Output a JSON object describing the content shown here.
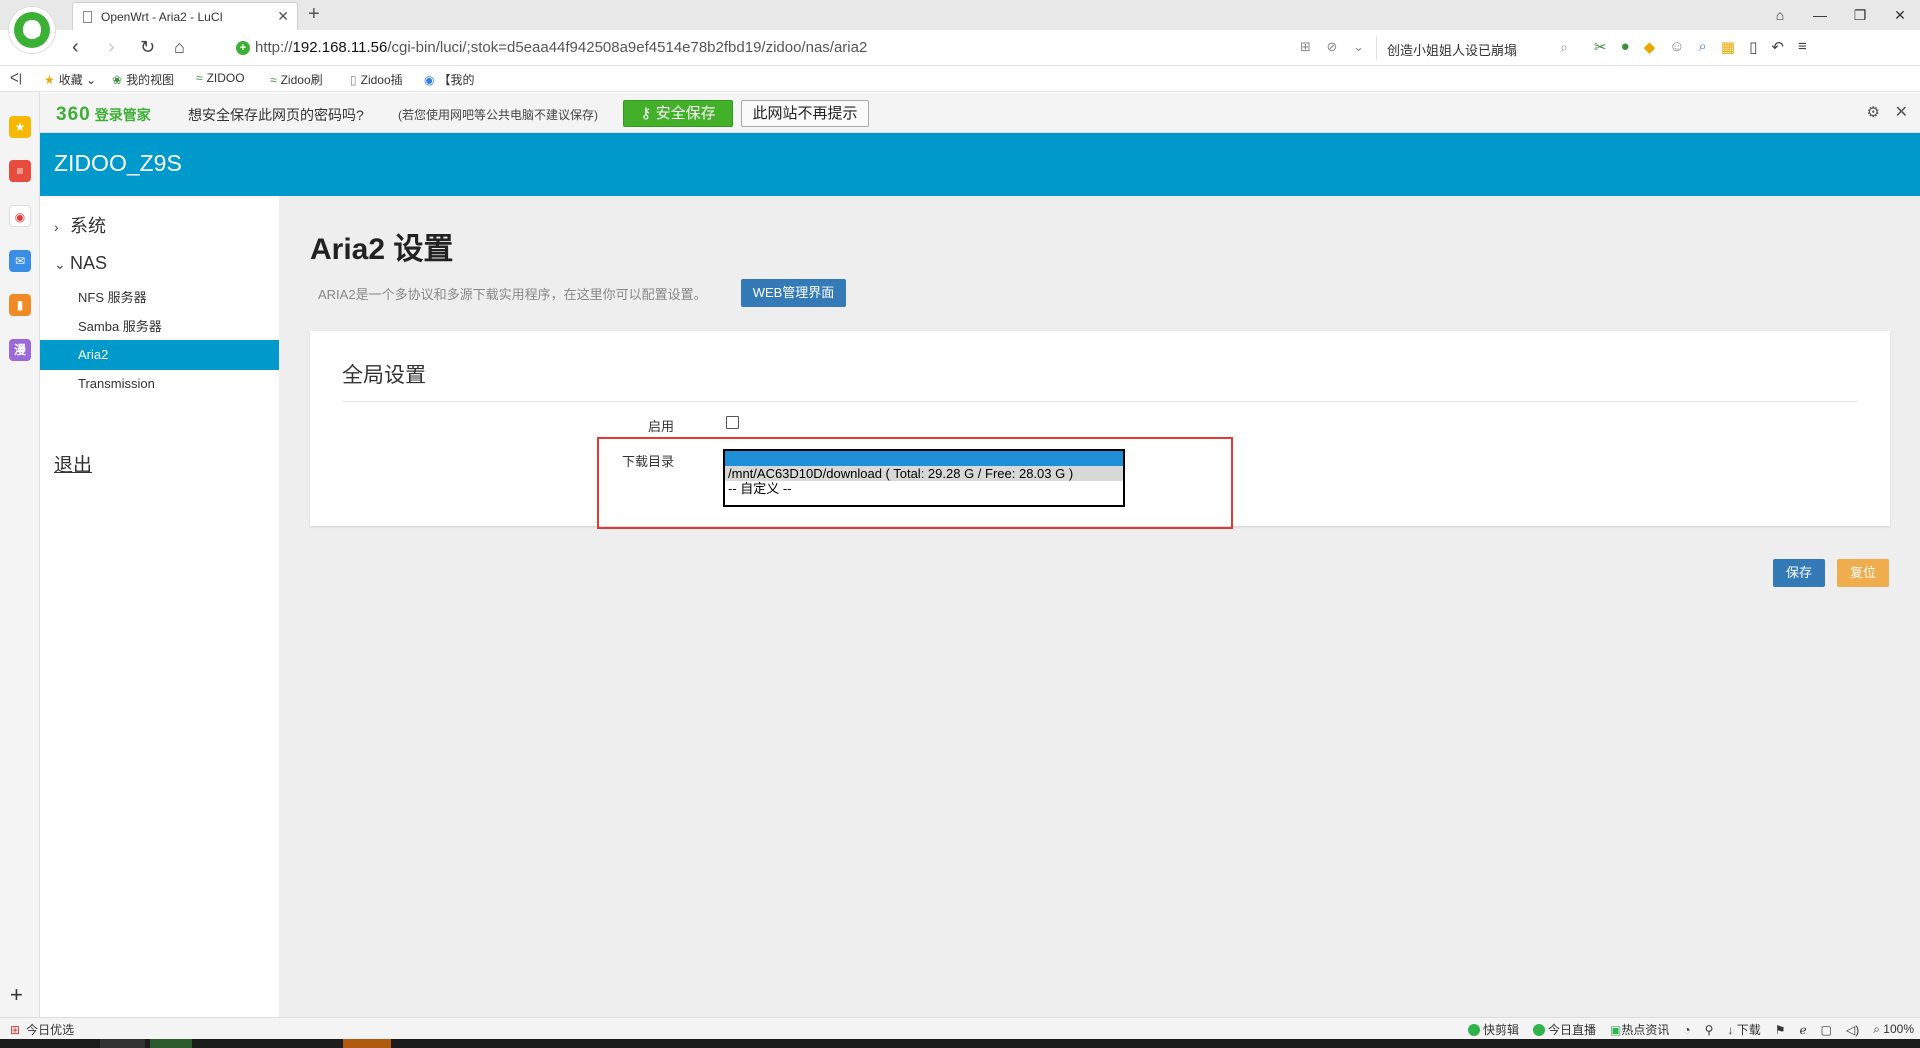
{
  "browser": {
    "tab_title": "OpenWrt - Aria2 - LuCI",
    "url_prefix": "http://",
    "url_host": "192.168.11.56",
    "url_path": "/cgi-bin/luci/;stok=d5eaa44f942508a9ef4514e78b2fbd19/zidoo/nas/aria2",
    "search_text": "创造小姐姐人设已崩塌",
    "bookmarks": [
      "收藏",
      "我的视图",
      "ZIDOO",
      "Zidoo刷",
      "Zidoo插",
      "【我的"
    ]
  },
  "pwbar": {
    "brand_logo": "360",
    "brand_text": "登录管家",
    "question": "想安全保存此网页的密码吗?",
    "note": "(若您使用网吧等公共电脑不建议保存)",
    "save_label": "安全保存",
    "nomore_label": "此网站不再提示"
  },
  "luci": {
    "brand": "ZIDOO_Z9S",
    "menu": {
      "system": "系统",
      "nas": "NAS",
      "items": [
        "NFS 服务器",
        "Samba 服务器",
        "Aria2",
        "Transmission"
      ],
      "logout": "退出"
    },
    "page_title": "Aria2 设置",
    "page_desc": "ARIA2是一个多协议和多源下载实用程序，在这里你可以配置设置。",
    "web_button": "WEB管理界面",
    "section_title": "全局设置",
    "enable_label": "启用",
    "enable_checked": false,
    "download_dir_label": "下载目录",
    "download_options": [
      "",
      "/mnt/AC63D10D/download ( Total: 29.28 G / Free: 28.03 G )",
      "-- 自定义 --"
    ],
    "save_button": "保存",
    "reset_button": "复位"
  },
  "statusbar": {
    "left": "今日优选",
    "items": [
      "快剪辑",
      "今日直播",
      "热点资讯",
      "下载",
      "100%"
    ]
  },
  "colors": {
    "header": "#0099cc",
    "primary_button": "#337ab7",
    "warning_button": "#f0ad4e",
    "highlight": "#e53935"
  }
}
